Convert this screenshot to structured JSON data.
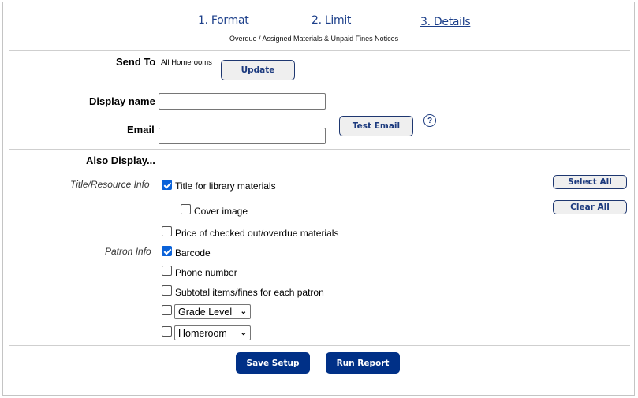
{
  "steps": [
    {
      "label": "1. Format",
      "active": false
    },
    {
      "label": "2. Limit",
      "active": false
    },
    {
      "label": "3. Details",
      "active": true
    }
  ],
  "subtitle": "Overdue / Assigned Materials & Unpaid Fines Notices",
  "send_to": {
    "label": "Send To",
    "value": "All Homerooms",
    "update_button": "Update"
  },
  "display_name": {
    "label": "Display name",
    "value": "",
    "placeholder": ""
  },
  "email": {
    "label": "Email",
    "value": "",
    "placeholder": "",
    "test_button": "Test Email",
    "help_icon": "?"
  },
  "also_display": {
    "heading": "Also Display...",
    "select_all": "Select All",
    "clear_all": "Clear All",
    "title_resource": {
      "label": "Title/Resource Info",
      "options": [
        {
          "label": "Title for library materials",
          "checked": true
        },
        {
          "label": "Cover image",
          "checked": false
        },
        {
          "label": "Price of checked out/overdue materials",
          "checked": false
        }
      ]
    },
    "patron": {
      "label": "Patron Info",
      "options": [
        {
          "label": "Barcode",
          "checked": true
        },
        {
          "label": "Phone number",
          "checked": false
        },
        {
          "label": "Subtotal items/fines for each patron",
          "checked": false
        }
      ],
      "selects": [
        {
          "selected": "Grade Level",
          "checked": false
        },
        {
          "selected": "Homeroom",
          "checked": false
        }
      ]
    }
  },
  "footer": {
    "save_button": "Save Setup",
    "run_button": "Run Report"
  },
  "colors": {
    "brand_blue": "#003087",
    "link_blue": "#1c3f8a",
    "checkbox_blue": "#0a62d9"
  }
}
